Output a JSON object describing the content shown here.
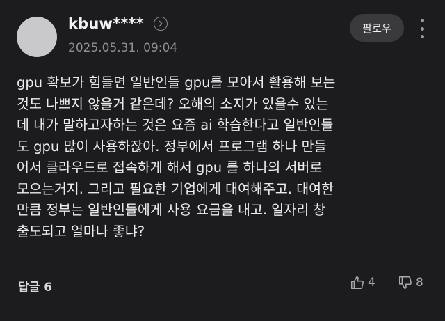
{
  "author": {
    "username": "kbuw****",
    "date": "2025.05.31. 09:04"
  },
  "actions": {
    "follow_label": "팔로우"
  },
  "comment": {
    "lines": [
      "gpu 확보가 힘들면 일반인들 gpu를 모아서 활용해 보는",
      "것도 나쁘지 않을거 같은데? 오해의 소지가 있을수 있는",
      "데 내가 말하고자하는 것은 요즘 ai 학습한다고 일반인들",
      "도 gpu 많이 사용하잖아. 정부에서 프로그램 하나 만들",
      "어서 클라우드로 접속하게 해서 gpu 를 하나의 서버로",
      "모으는거지. 그리고 필요한 기업에게 대여해주고. 대여한",
      "만큼 정부는 일반인들에게 사용 요금을 내고. 일자리 창",
      "출도되고 얼마나 좋냐?"
    ]
  },
  "footer": {
    "replies_label": "답글",
    "replies_count": "6",
    "likes": "4",
    "dislikes": "8"
  },
  "icons": {
    "profile_chevron": "chevron-right-icon",
    "more": "more-vertical-icon",
    "like": "thumbs-up-icon",
    "dislike": "thumbs-down-icon"
  }
}
